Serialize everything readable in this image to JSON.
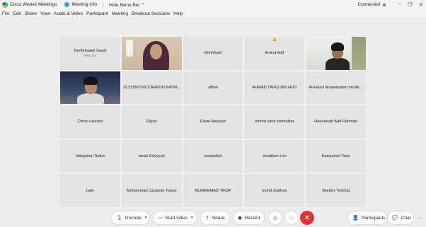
{
  "titlebar": {
    "app_title": "Cisco Webex Meetings",
    "info_title": "Meeting Info",
    "menu_toggle": "Hide Menu Bar",
    "status": "Connected"
  },
  "menu": [
    "File",
    "Edit",
    "Share",
    "View",
    "Audio & Video",
    "Participant",
    "Meeting",
    "Breakout Sessions",
    "Help"
  ],
  "participants": [
    {
      "name": "Nurfitriyaani Saudi",
      "sub": "Host, me"
    },
    {
      "name": "",
      "video": "hijab"
    },
    {
      "name": "EhhhKatil"
    },
    {
      "name": "Amirul Aqif",
      "warn": true
    },
    {
      "name": "",
      "video": "boy1"
    },
    {
      "name": "",
      "video": "boy2"
    },
    {
      "name": "15.528907MCCARRON RAYM..."
    },
    {
      "name": "afifah"
    },
    {
      "name": "AHMAD TARIQ BIN HUD"
    },
    {
      "name": "Al-Faizul Muawizatain bin Ab..."
    },
    {
      "name": "Christ Laursen"
    },
    {
      "name": "Ellysa"
    },
    {
      "name": "Elyna Natasya"
    },
    {
      "name": "emma zatul normalina"
    },
    {
      "name": "Hairunisah Abd Rahman"
    },
    {
      "name": "Hidayatun Nufus"
    },
    {
      "name": "Izzati Zakiyyah"
    },
    {
      "name": "Jacquellyn"
    },
    {
      "name": "Jonathan Loh"
    },
    {
      "name": "Kaviyahsri Vasu"
    },
    {
      "name": "Laily"
    },
    {
      "name": "Mohammad Izzuandy Yusop"
    },
    {
      "name": "MUHAMMAD TAQIF"
    },
    {
      "name": "muhd zhafiran"
    },
    {
      "name": "Murphy Tedong"
    }
  ],
  "toolbar": {
    "unmute": "Unmute",
    "start_video": "Start video",
    "share": "Share",
    "record": "Record",
    "participants": "Participants",
    "chat": "Chat"
  },
  "colors": {
    "end_call": "#d93737",
    "connected": "#2fa84f",
    "warning": "#e8a21f"
  }
}
